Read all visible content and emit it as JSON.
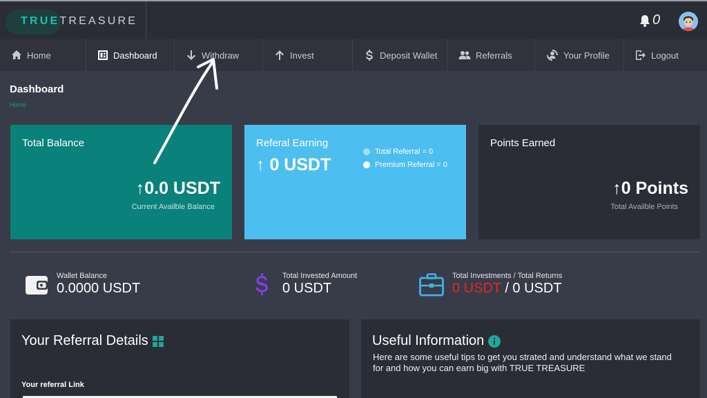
{
  "brand": {
    "part1": "TRUE",
    "part2": "TREASURE"
  },
  "header": {
    "notification_count": "0",
    "bell_icon": "bell-icon",
    "avatar_icon": "user-avatar-icon"
  },
  "nav": {
    "items": [
      {
        "label": "Home",
        "icon": "home-icon"
      },
      {
        "label": "Dashboard",
        "icon": "dashboard-icon"
      },
      {
        "label": "Withdraw",
        "icon": "arrow-down-icon"
      },
      {
        "label": "Invest",
        "icon": "arrow-up-icon"
      },
      {
        "label": "Deposit Wallet",
        "icon": "dollar-icon"
      },
      {
        "label": "Referrals",
        "icon": "users-icon"
      },
      {
        "label": "Your Profile",
        "icon": "profile-icon"
      },
      {
        "label": "Logout",
        "icon": "logout-icon"
      }
    ]
  },
  "page": {
    "title": "Dashboard",
    "breadcrumb": "Home"
  },
  "cards": {
    "total_balance": {
      "title": "Total Balance",
      "amount": "↑0.0 USDT",
      "sub": "Current Availble Balance"
    },
    "referral_earning": {
      "title": "Referal Earning",
      "amount": "↑ 0 USDT",
      "total_referral": "Total Referral = 0",
      "premium_referral": "Premium Referral = 0"
    },
    "points": {
      "title": "Points Earned",
      "amount": "↑0 Points",
      "sub": "Total Availble Points"
    }
  },
  "stats": {
    "wallet": {
      "label": "Wallet Balance",
      "value": "0.0000 USDT"
    },
    "invested": {
      "label": "Total Invested Amount",
      "value": "0 USDT"
    },
    "investments": {
      "label": "Total Investments / Total Returns",
      "value_red": "0 USDT",
      "value_rest": " / 0 USDT"
    }
  },
  "referral_panel": {
    "title": "Your Referral Details",
    "link_label": "Your referral Link"
  },
  "info_panel": {
    "title": "Useful Information",
    "text": "Here are some useful tips to get you strated and understand what we stand for and how you can earn big with TRUE TREASURE"
  },
  "colors": {
    "teal": "#0a827b",
    "sky": "#4dbef0",
    "accent": "#1ec0b4",
    "red": "#e3262f"
  }
}
